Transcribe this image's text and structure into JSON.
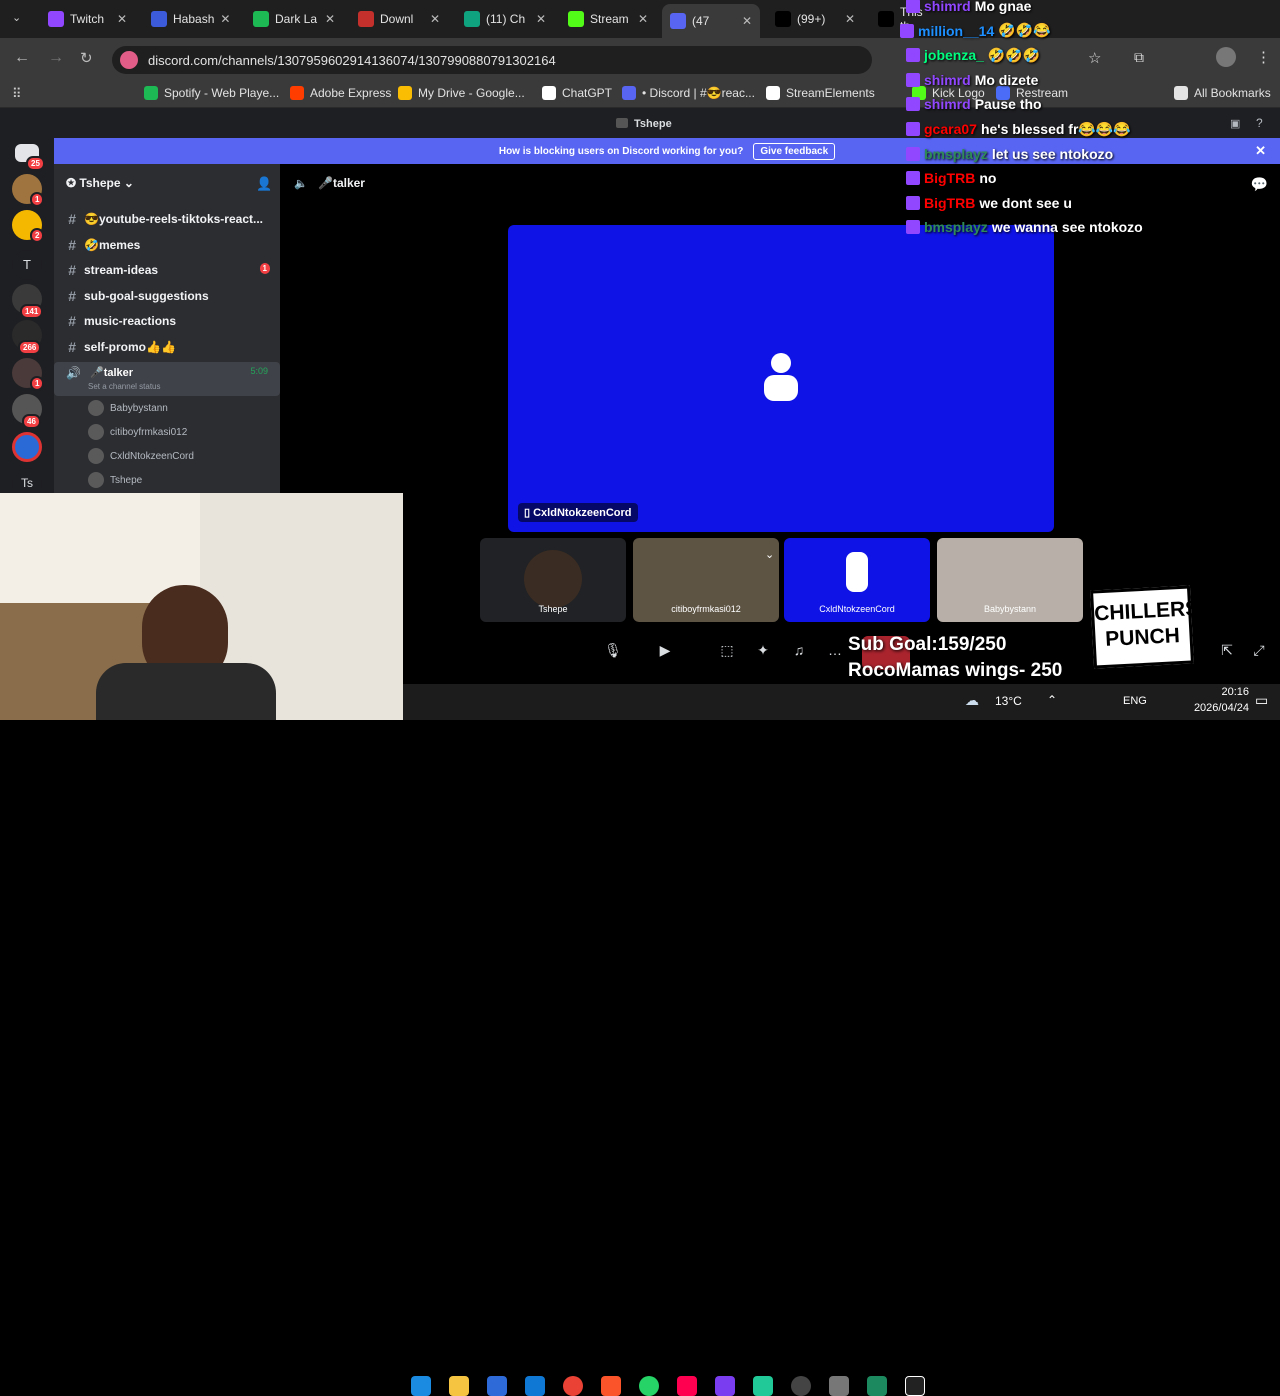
{
  "tabs": [
    {
      "label": "Twitch",
      "color": "#9146ff"
    },
    {
      "label": "Habash",
      "color": "#3b5bdb"
    },
    {
      "label": "Dark La",
      "color": "#1db954"
    },
    {
      "label": "Downl",
      "color": "#c4302b"
    },
    {
      "label": "(11) Ch",
      "color": "#10a37f"
    },
    {
      "label": "Stream",
      "color": "#53fc18"
    },
    {
      "label": "(47",
      "color": "#5865f2"
    },
    {
      "label": "(99+)",
      "color": "#000000"
    },
    {
      "label": "This th",
      "color": "#000000"
    }
  ],
  "url": "discord.com/channels/1307959602914136074/1307990880791302164",
  "bookmarks": [
    {
      "label": "Spotify - Web Playe...",
      "color": "#1db954"
    },
    {
      "label": "Adobe Express",
      "color": "#ff3d00"
    },
    {
      "label": "My Drive - Google...",
      "color": "#fbbc04"
    },
    {
      "label": "ChatGPT",
      "color": "#ffffff"
    },
    {
      "label": "• Discord | #😎reac...",
      "color": "#5865f2"
    },
    {
      "label": "StreamElements",
      "color": "#ffffff"
    },
    {
      "label": "Kick Logo",
      "color": "#53fc18"
    },
    {
      "label": "Restream",
      "color": "#4b6cf7"
    },
    {
      "label": "All Bookmarks",
      "color": "#e3e3e3"
    }
  ],
  "window_title": "Tshepe",
  "banner": {
    "text": "How is blocking users on Discord working for you?",
    "button": "Give feedback"
  },
  "server": {
    "name": "Tshepe"
  },
  "servers": [
    {
      "badge": "25"
    },
    {
      "badge": "1"
    },
    {
      "badge": "2"
    },
    {
      "label": "T"
    },
    {
      "badge": "141"
    },
    {
      "badge": "266"
    },
    {
      "badge": "1"
    },
    {
      "badge": "46"
    },
    {
      "badge": ""
    },
    {
      "label": "Ts"
    }
  ],
  "channels": [
    {
      "name": "😎youtube-reels-tiktoks-react...",
      "unread": ""
    },
    {
      "name": "🤣memes",
      "unread": ""
    },
    {
      "name": "stream-ideas",
      "unread": "1"
    },
    {
      "name": "sub-goal-suggestions",
      "unread": ""
    },
    {
      "name": "music-reactions",
      "unread": ""
    },
    {
      "name": "self-promo👍👍",
      "unread": ""
    }
  ],
  "voice": {
    "name": "🎤talker",
    "timer": "5:09",
    "status": "Set a channel status",
    "users": [
      "Babybystann",
      "citiboyfrmkasi012",
      "CxldNtokzeenCord",
      "Tshepe"
    ]
  },
  "stage": {
    "channel": "🎤talker",
    "main_label": "CxldNtokzeenCord",
    "tiles": [
      "Tshepe",
      "citiboyfrmkasi012",
      "CxldNtokzeenCord",
      "Babybystann"
    ]
  },
  "chat": [
    {
      "name": "shimrd",
      "color": "#9147ff",
      "msg": "Mo gnae"
    },
    {
      "name": "million__14",
      "color": "#1e90ff",
      "msg": "🤣🤣😂"
    },
    {
      "name": "jobenza_",
      "color": "#00ff7f",
      "msg": "🤣🤣🤣"
    },
    {
      "name": "shimrd",
      "color": "#9147ff",
      "msg": "Mo dizete"
    },
    {
      "name": "shimrd",
      "color": "#9147ff",
      "msg": "Pause tho"
    },
    {
      "name": "gcara07",
      "color": "#ff0000",
      "msg": "he's blessed fr😂😂😂"
    },
    {
      "name": "bmsplayz",
      "color": "#2e8b57",
      "msg": "let us see ntokozo"
    },
    {
      "name": "BigTRB",
      "color": "#ff0000",
      "msg": "no"
    },
    {
      "name": "BigTRB",
      "color": "#ff0000",
      "msg": "we dont see u"
    },
    {
      "name": "bmsplayz",
      "color": "#2e8b57",
      "msg": "we wanna see ntokozo"
    }
  ],
  "overlay": {
    "subgoal": "Sub Goal:159/250",
    "wings": "RocoMamas wings- 250",
    "logo_line1": "CHILLERS",
    "logo_line2": "PUNCH"
  },
  "taskbar": {
    "weather": "13°C",
    "lang": "ENG",
    "time": "20:16",
    "date": "2026/04/24"
  }
}
